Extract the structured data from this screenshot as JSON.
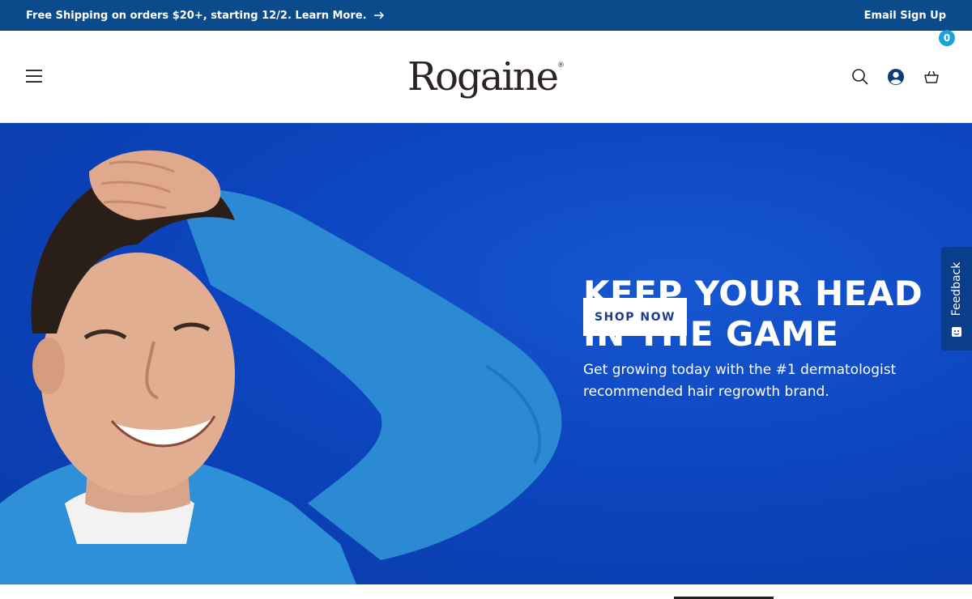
{
  "announcement": {
    "text": "Free Shipping on orders $20+, starting 12/2. Learn More.",
    "email_signup": "Email Sign Up"
  },
  "header": {
    "logo_text": "Rogaine",
    "logo_mark": "®",
    "cart_count": "0"
  },
  "hero": {
    "title_line1": "KEEP YOUR HEAD",
    "title_line2": "IN THE GAME",
    "subtitle": "Get growing today with the #1 dermatologist recommended hair regrowth brand.",
    "cta": "SHOP NOW"
  },
  "feedback": {
    "label": "Feedback"
  },
  "colors": {
    "announcement_bg": "#0b4a8b",
    "hero_bg": "#0c45bf",
    "cart_badge": "#1aa3d9",
    "cta_text": "#1c3d8f"
  },
  "icons": [
    "arrow-right-icon",
    "menu-icon",
    "search-icon",
    "account-icon",
    "cart-icon",
    "feedback-icon"
  ]
}
